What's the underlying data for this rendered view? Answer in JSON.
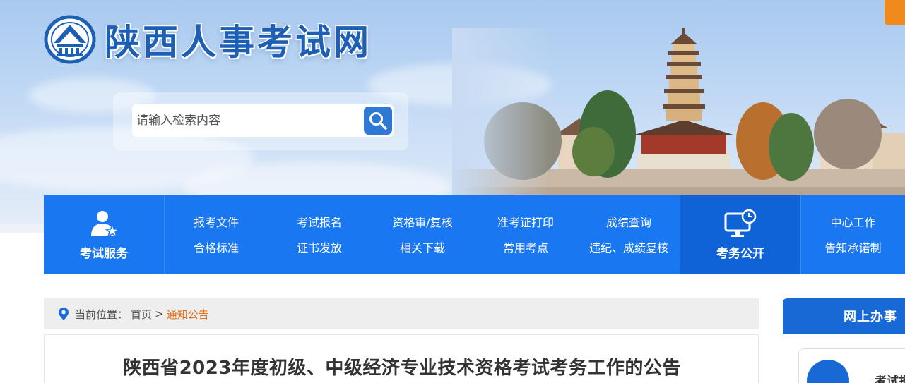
{
  "site": {
    "title": "陕西人事考试网"
  },
  "search": {
    "placeholder": "请输入检索内容"
  },
  "nav": {
    "exam_service_label": "考试服务",
    "exam_public_label": "考务公开",
    "links": [
      "报考文件",
      "考试报名",
      "资格审/复核",
      "准考证打印",
      "成绩查询",
      "合格标准",
      "证书发放",
      "相关下载",
      "常用考点",
      "违纪、成绩复核"
    ],
    "right_links": [
      "中心工作",
      "告知承诺制"
    ]
  },
  "breadcrumb": {
    "prefix": "当前位置：",
    "home": "首页",
    "separator": ">",
    "current": "通知公告"
  },
  "article": {
    "title": "陕西省2023年度初级、中级经济专业技术资格考试考务工作的公告"
  },
  "sidebar": {
    "header": "网上办事",
    "card_label": "考试报名"
  },
  "colors": {
    "nav_blue": "#1977f2",
    "nav_dark": "#0f63d6",
    "breadcrumb_current": "#e0701a",
    "orange_tab": "#f08a1c"
  },
  "icons": [
    "logo-emblem-icon",
    "search-icon",
    "user-star-icon",
    "monitor-clock-icon",
    "location-pin-icon"
  ]
}
